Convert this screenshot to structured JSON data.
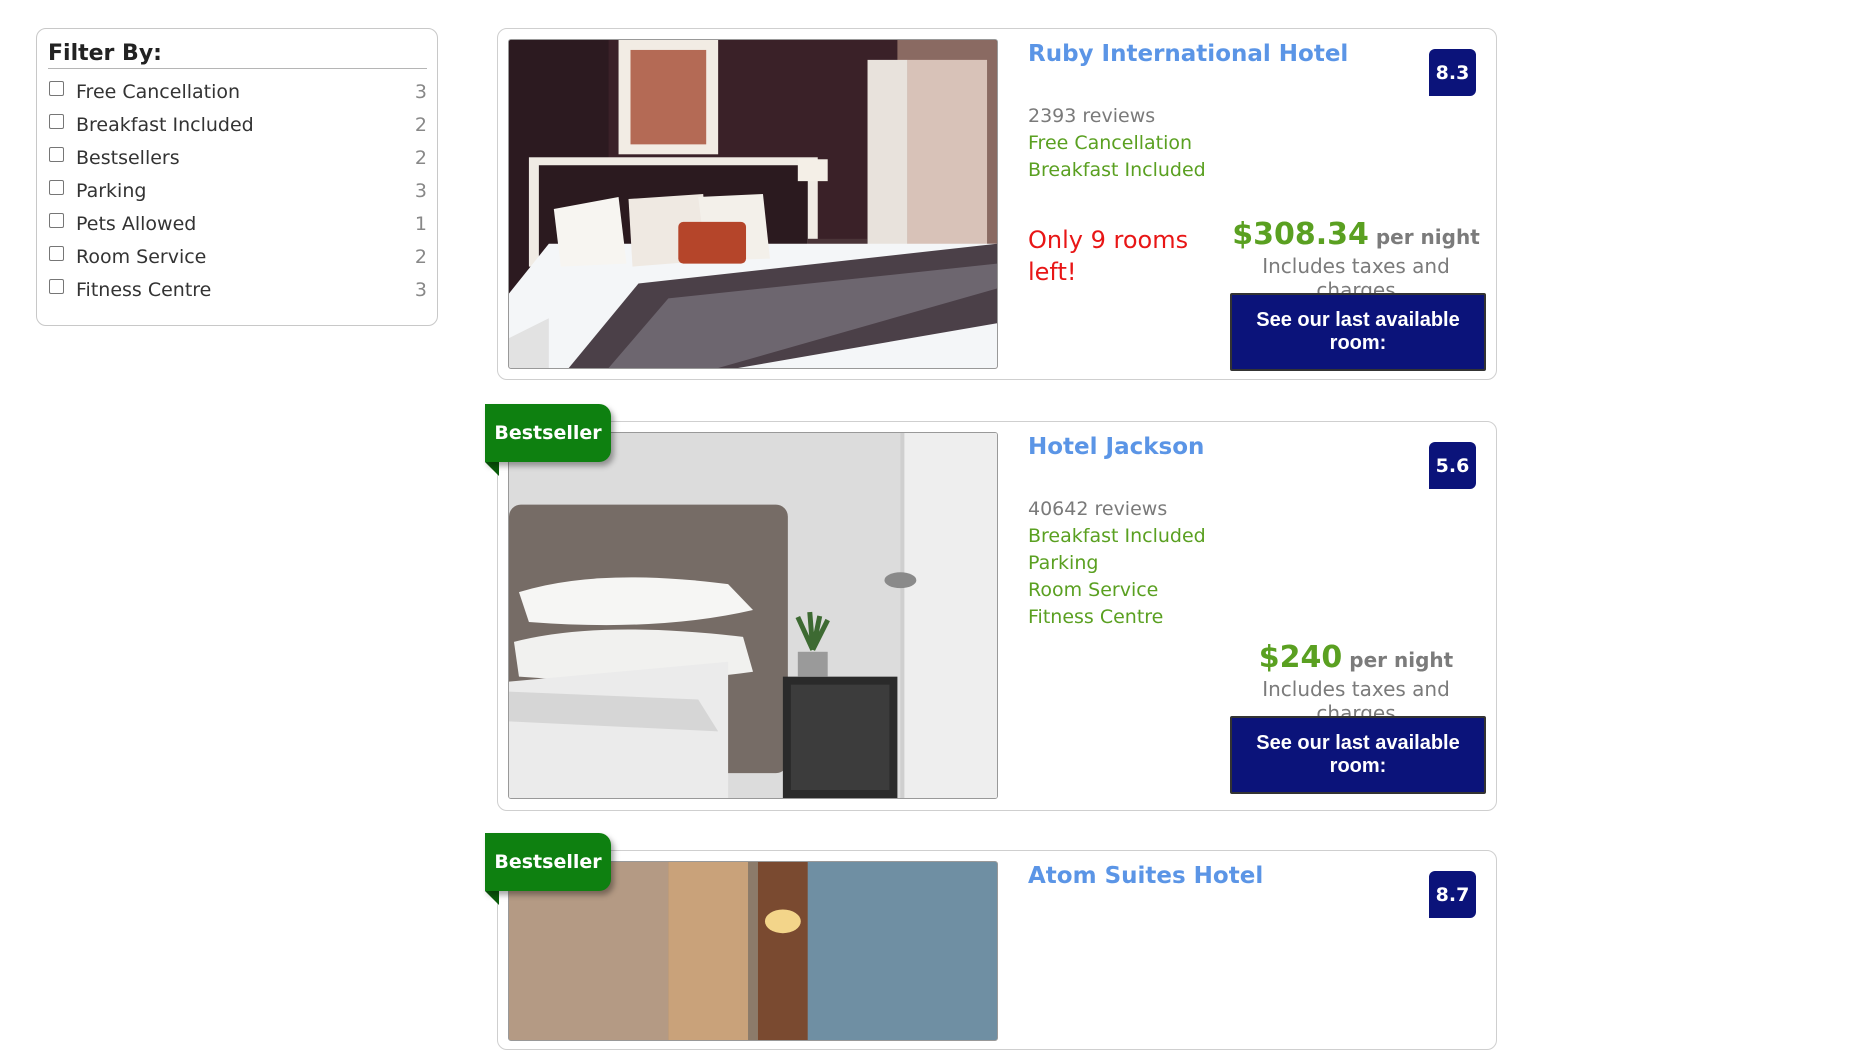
{
  "filter": {
    "title": "Filter By:",
    "items": [
      {
        "label": "Free Cancellation",
        "count": "3"
      },
      {
        "label": "Breakfast Included",
        "count": "2"
      },
      {
        "label": "Bestsellers",
        "count": "2"
      },
      {
        "label": "Parking",
        "count": "3"
      },
      {
        "label": "Pets Allowed",
        "count": "1"
      },
      {
        "label": "Room Service",
        "count": "2"
      },
      {
        "label": "Fitness Centre",
        "count": "3"
      }
    ]
  },
  "hotels": [
    {
      "name": "Ruby International Hotel",
      "score": "8.3",
      "reviews": "2393 reviews",
      "amenities": [
        "Free Cancellation",
        "Breakfast Included"
      ],
      "scarcity": "Only 9 rooms left!",
      "price": "$308.34",
      "per_night": "per night",
      "taxes": "Includes taxes and charges",
      "cta": "See our last available room:"
    },
    {
      "ribbon": "Bestseller",
      "name": "Hotel Jackson",
      "score": "5.6",
      "reviews": "40642 reviews",
      "amenities": [
        "Breakfast Included",
        "Parking",
        "Room Service",
        "Fitness Centre"
      ],
      "price": "$240",
      "per_night": "per night",
      "taxes": "Includes taxes and charges",
      "cta": "See our last available room:"
    },
    {
      "ribbon": "Bestseller",
      "name": "Atom Suites Hotel",
      "score": "8.7"
    }
  ],
  "colors": {
    "accent_blue": "#5b95e6",
    "navy": "#0b137a",
    "amenity_green": "#5aa021",
    "ribbon_green": "#0e8010",
    "scarcity_red": "#e81616"
  }
}
